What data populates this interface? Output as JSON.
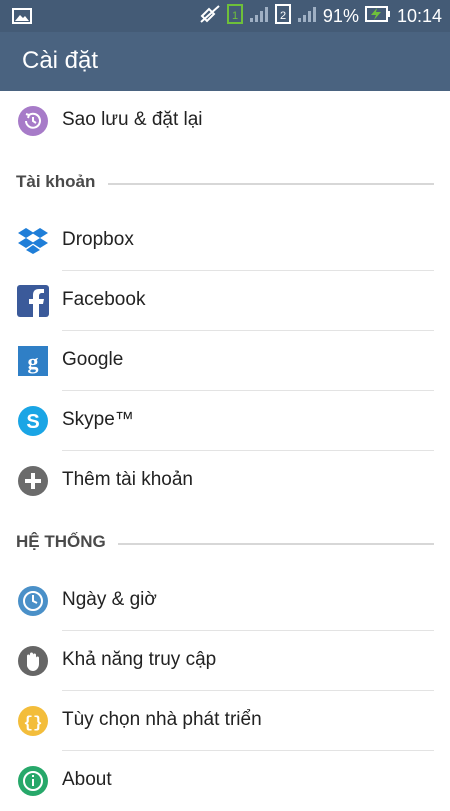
{
  "status_bar": {
    "battery_percent": "91%",
    "time": "10:14",
    "sim1_label": "1",
    "sim2_label": "2",
    "icons": [
      "gallery-icon",
      "mute-icon",
      "sim1-icon",
      "signal-icon",
      "sim2-icon",
      "signal-icon",
      "battery-charging-icon"
    ]
  },
  "app_bar": {
    "title": "Cài đặt"
  },
  "top_item": {
    "label": "Sao lưu & đặt lại",
    "icon": "backup-restore-icon"
  },
  "accounts_section": {
    "title": "Tài khoản",
    "items": [
      {
        "label": "Dropbox",
        "icon": "dropbox-icon"
      },
      {
        "label": "Facebook",
        "icon": "facebook-icon"
      },
      {
        "label": "Google",
        "icon": "google-icon"
      },
      {
        "label": "Skype™",
        "icon": "skype-icon"
      },
      {
        "label": "Thêm tài khoản",
        "icon": "add-account-icon"
      }
    ]
  },
  "system_section": {
    "title": "HỆ THỐNG",
    "items": [
      {
        "label": "Ngày & giờ",
        "icon": "clock-icon"
      },
      {
        "label": "Khả năng truy cập",
        "icon": "accessibility-hand-icon"
      },
      {
        "label": "Tùy chọn nhà phát triển",
        "icon": "developer-options-icon"
      },
      {
        "label": "About",
        "icon": "info-icon"
      }
    ]
  },
  "colors": {
    "status_bar_bg": "#445b76",
    "app_bar_bg": "#4a6380",
    "backup_icon": "#a77bc8",
    "dropbox_icon": "#1f7ed8",
    "facebook_icon": "#3b5a9a",
    "google_icon": "#2f7fc6",
    "skype_icon": "#1aa5e5",
    "add_icon": "#6b6b6b",
    "clock_icon": "#4a90c8",
    "hand_icon": "#666666",
    "dev_icon": "#f3bd3b",
    "info_icon": "#27a86a"
  }
}
